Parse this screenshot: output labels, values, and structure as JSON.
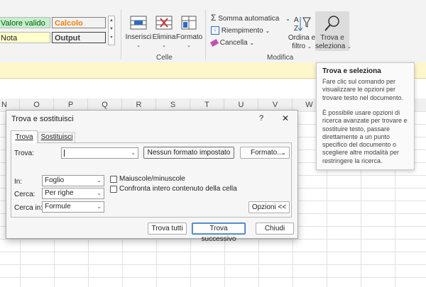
{
  "styles": {
    "valore_valido": "Valore valido",
    "calcolo": "Calcolo",
    "nota": "Nota",
    "output": "Output"
  },
  "ribbon": {
    "inserisci": "Inserisci",
    "elimina": "Elimina",
    "formato": "Formato",
    "celle_group": "Celle",
    "somma_automatica": "Somma automatica",
    "riempimento": "Riempimento",
    "cancella": "Cancella",
    "ordina_line1": "Ordina e",
    "ordina_line2": "filtro",
    "trova_line1": "Trova e",
    "trova_line2": "seleziona",
    "modifica_group": "Modifica"
  },
  "columns": [
    "N",
    "O",
    "P",
    "Q",
    "R",
    "S",
    "T",
    "U",
    "V",
    "W"
  ],
  "dialog": {
    "title": "Trova e sostituisci",
    "help": "?",
    "close": "✕",
    "tab_trova": "Trova",
    "tab_sostituisci": "Sostituisci",
    "trova_label": "Trova:",
    "trova_value": "",
    "nessun_formato": "Nessun formato impostato",
    "formato_btn": "Formato...",
    "in_label": "In:",
    "in_value": "Foglio",
    "cerca_label": "Cerca:",
    "cerca_value": "Per righe",
    "cerca_in_label": "Cerca in:",
    "cerca_in_value": "Formule",
    "maiuscole": "Maiuscole/minuscole",
    "confronta": "Confronta intero contenuto della cella",
    "opzioni": "Opzioni <<",
    "trova_tutti": "Trova tutti",
    "trova_successivo": "Trova successivo",
    "chiudi": "Chiudi"
  },
  "tooltip": {
    "title": "Trova e seleziona",
    "p1": "Fare clic sul comando per visualizzare le opzioni per trovare testo nel documento.",
    "p2": "È possibile usare opzioni di ricerca avanzate per trovare e sostituire testo, passare direttamente a un punto specifico del documento o scegliere altre modalità per restringere la ricerca."
  },
  "colors": {
    "valore_valido_bg": "#c6efce",
    "valore_valido_fg": "#006100",
    "calcolo_bg": "#f2f2f2",
    "calcolo_fg": "#fa7d00",
    "nota_bg": "#ffffcc",
    "output_bg": "#f2f2f2",
    "accent": "#3b79c9"
  }
}
